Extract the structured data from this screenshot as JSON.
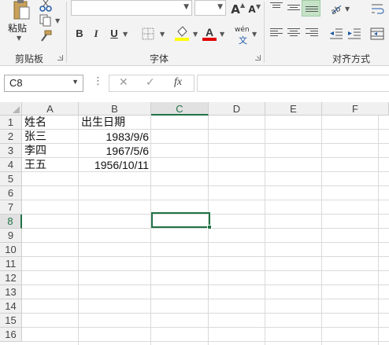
{
  "ribbon": {
    "groups": {
      "clipboard": {
        "label": "剪贴板",
        "paste_label": "粘贴"
      },
      "font": {
        "label": "字体"
      },
      "alignment": {
        "label": "对齐方式"
      }
    },
    "font_buttons": {
      "bold": "B",
      "italic": "I",
      "underline": "U",
      "grow": "A",
      "shrink": "A",
      "phonetic": "wén"
    },
    "colors": {
      "highlight": "#ffff00",
      "font_color": "#e00000",
      "selected_align": "#c6e3c8"
    }
  },
  "formula_bar": {
    "name_box": "C8",
    "fx_label": "fx",
    "formula": ""
  },
  "sheet": {
    "columns": [
      "A",
      "B",
      "C",
      "D",
      "E",
      "F"
    ],
    "rows": [
      "1",
      "2",
      "3",
      "4",
      "5",
      "6",
      "7",
      "8",
      "9",
      "10",
      "11",
      "12",
      "13",
      "14",
      "15",
      "16"
    ],
    "active_cell": "C8",
    "cells": {
      "A1": "姓名",
      "B1": "出生日期",
      "A2": "张三",
      "B2": "1983/9/6",
      "A3": "李四",
      "B3": "1967/5/6",
      "A4": "王五",
      "B4": "1956/10/11"
    }
  }
}
